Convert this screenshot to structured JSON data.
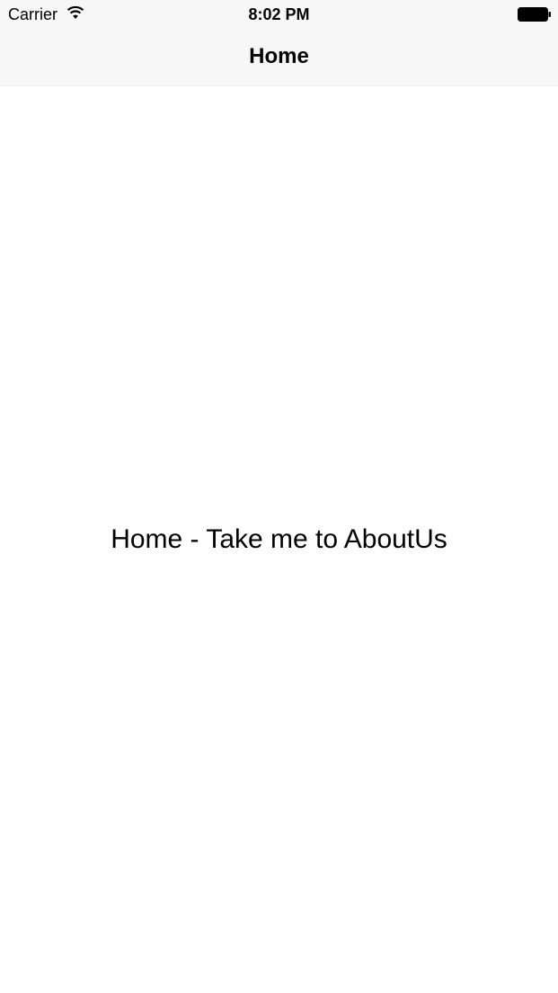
{
  "status_bar": {
    "carrier": "Carrier",
    "time": "8:02 PM",
    "wifi_icon": "wifi-icon",
    "battery_icon": "battery-icon"
  },
  "nav_bar": {
    "title": "Home",
    "background": "#f7f7f7"
  },
  "main": {
    "link_text": "Home - Take me to AboutUs"
  }
}
